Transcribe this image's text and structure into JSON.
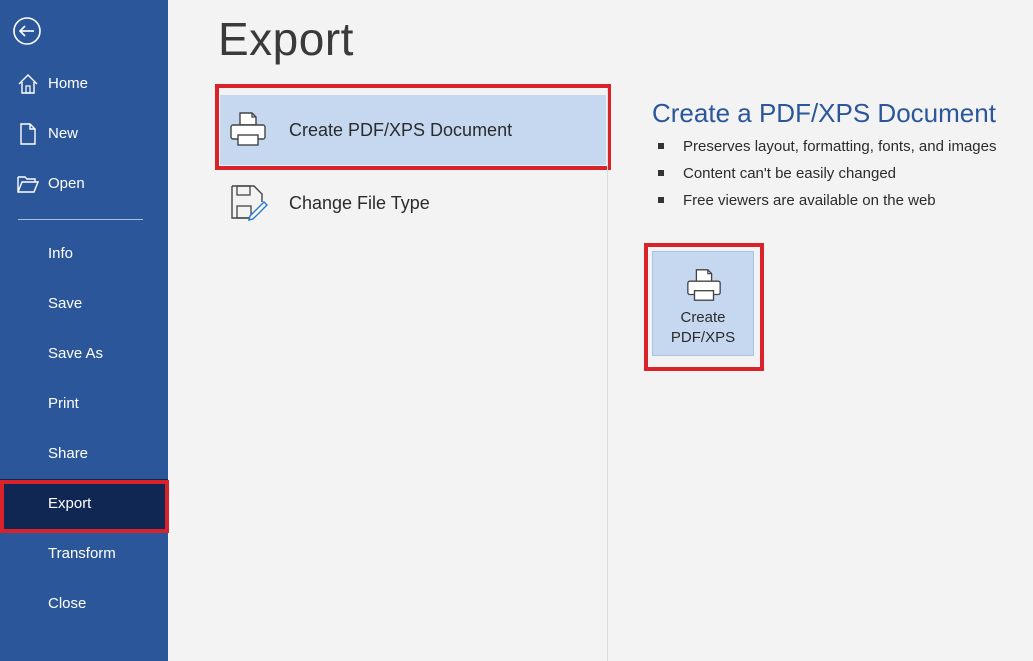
{
  "sidebar": {
    "back_icon": "back-arrow-icon",
    "items_top": [
      {
        "label": "Home",
        "icon": "home-icon"
      },
      {
        "label": "New",
        "icon": "new-document-icon"
      },
      {
        "label": "Open",
        "icon": "open-folder-icon"
      }
    ],
    "items": [
      {
        "label": "Info"
      },
      {
        "label": "Save"
      },
      {
        "label": "Save As"
      },
      {
        "label": "Print"
      },
      {
        "label": "Share"
      },
      {
        "label": "Export",
        "active": true
      },
      {
        "label": "Transform"
      },
      {
        "label": "Close"
      }
    ],
    "bg_color": "#2b579a",
    "active_color": "#0f2752"
  },
  "main": {
    "title": "Export",
    "options": [
      {
        "label": "Create PDF/XPS Document",
        "icon": "printer-pdf-icon",
        "selected": true
      },
      {
        "label": "Change File Type",
        "icon": "change-file-type-icon",
        "selected": false
      }
    ],
    "detail": {
      "title": "Create a PDF/XPS Document",
      "bullets": [
        "Preserves layout, formatting, fonts, and images",
        "Content can't be easily changed",
        "Free viewers are available on the web"
      ],
      "button_label_line1": "Create",
      "button_label_line2": "PDF/XPS",
      "button_icon": "printer-pdf-icon"
    }
  },
  "colors": {
    "accent": "#2b579a",
    "highlight": "#d9222a",
    "selected_bg": "#c5d8f0"
  }
}
